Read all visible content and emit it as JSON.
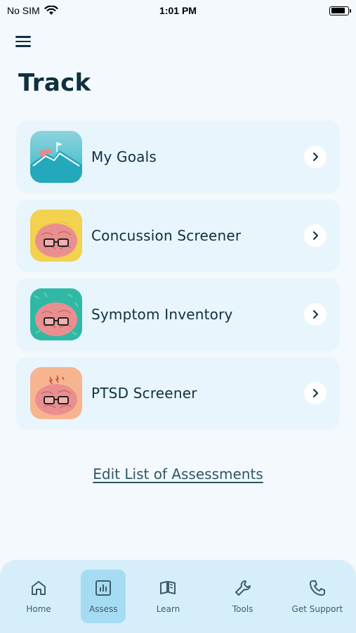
{
  "status_bar": {
    "carrier": "No SIM",
    "time": "1:01 PM"
  },
  "page": {
    "title": "Track"
  },
  "assessments": [
    {
      "label": "My Goals",
      "icon": "goals-mountain-icon"
    },
    {
      "label": "Concussion Screener",
      "icon": "brain-yellow-icon"
    },
    {
      "label": "Symptom Inventory",
      "icon": "brain-teal-icon"
    },
    {
      "label": "PTSD Screener",
      "icon": "brain-peach-icon"
    }
  ],
  "edit_link": "Edit List of Assessments",
  "tabs": [
    {
      "label": "Home",
      "icon": "home-icon",
      "active": false
    },
    {
      "label": "Assess",
      "icon": "chart-icon",
      "active": true
    },
    {
      "label": "Learn",
      "icon": "book-icon",
      "active": false
    },
    {
      "label": "Tools",
      "icon": "wrench-icon",
      "active": false
    },
    {
      "label": "Get Support",
      "icon": "phone-icon",
      "active": false
    }
  ],
  "colors": {
    "background": "#f3f9fd",
    "card": "#e8f5fc",
    "tab_bar": "#d6eef9",
    "tab_active": "#a6dcf3",
    "text": "#10303e"
  }
}
